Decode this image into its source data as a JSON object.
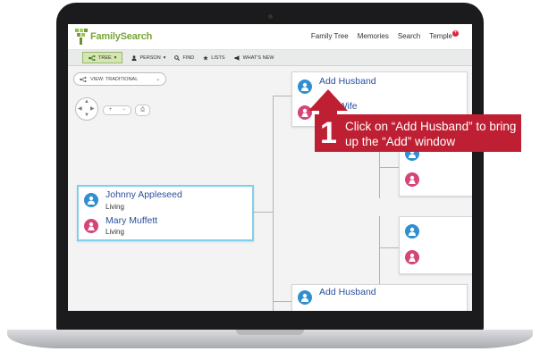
{
  "app": {
    "logo_text": "FamilySearch"
  },
  "nav": {
    "items": [
      "Family Tree",
      "Memories",
      "Search",
      "Temple"
    ],
    "temple_badge": "+"
  },
  "toolbar": {
    "tree": "TREE",
    "person": "PERSON",
    "find": "FIND",
    "lists": "LISTS",
    "whats_new": "WHAT'S NEW"
  },
  "view": {
    "label": "VIEW: TRADITIONAL"
  },
  "controls": {
    "zoom_in": "+",
    "zoom_out": "−"
  },
  "couple": {
    "husband": {
      "name": "Johnny Appleseed",
      "status": "Living"
    },
    "wife": {
      "name": "Mary Muffett",
      "status": "Living"
    }
  },
  "parents_top": {
    "add_husband": "Add Husband",
    "add_wife": "Add Wife"
  },
  "parents_bottom": {
    "add_husband": "Add Husband"
  },
  "callout": {
    "number": "1",
    "text": "Click on “Add Husband” to bring up the “Add” window"
  },
  "colors": {
    "accent_red": "#bf1f32",
    "link_blue": "#2a4f9c",
    "male": "#2f8fd0",
    "female": "#d6457a",
    "focus": "#7fd0ec"
  }
}
